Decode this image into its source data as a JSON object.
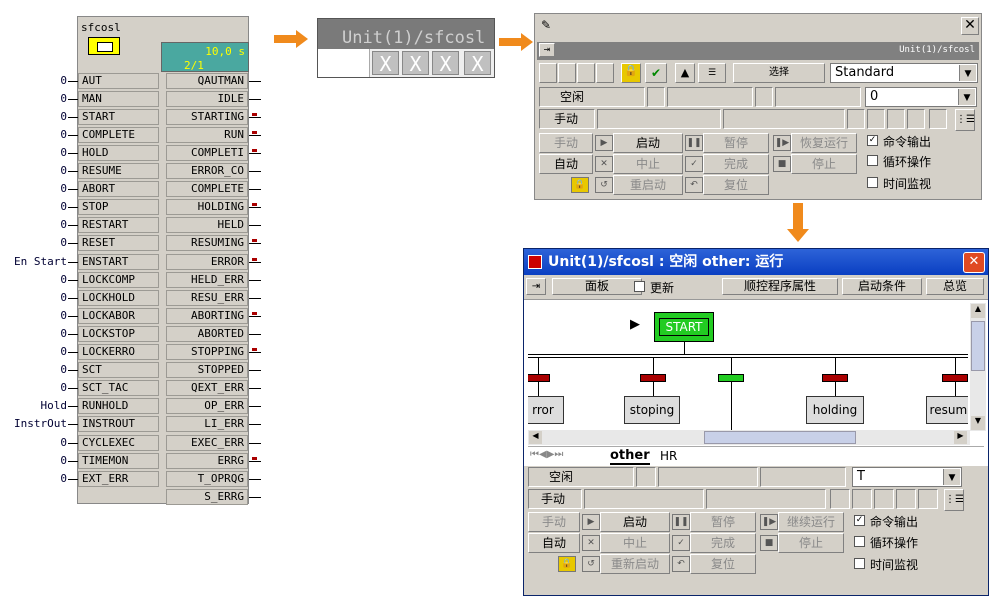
{
  "block": {
    "name": "sfcosl",
    "status_value": "10,0 s",
    "status_step": "2/1",
    "inputs": [
      {
        "name": "AUT",
        "value": "0"
      },
      {
        "name": "MAN",
        "value": "0"
      },
      {
        "name": "START",
        "value": "0"
      },
      {
        "name": "COMPLETE",
        "value": "0"
      },
      {
        "name": "HOLD",
        "value": "0"
      },
      {
        "name": "RESUME",
        "value": "0"
      },
      {
        "name": "ABORT",
        "value": "0"
      },
      {
        "name": "STOP",
        "value": "0"
      },
      {
        "name": "RESTART",
        "value": "0"
      },
      {
        "name": "RESET",
        "value": "0"
      },
      {
        "name": "ENSTART",
        "value": "En Start"
      },
      {
        "name": "LOCKCOMP",
        "value": "0"
      },
      {
        "name": "LOCKHOLD",
        "value": "0"
      },
      {
        "name": "LOCKABOR",
        "value": "0"
      },
      {
        "name": "LOCKSTOP",
        "value": "0"
      },
      {
        "name": "LOCKERRO",
        "value": "0"
      },
      {
        "name": "SCT",
        "value": "0"
      },
      {
        "name": "SCT_TAC",
        "value": "0"
      },
      {
        "name": "RUNHOLD",
        "value": "Hold"
      },
      {
        "name": "INSTROUT",
        "value": "InstrOut"
      },
      {
        "name": "CYCLEXEC",
        "value": "0"
      },
      {
        "name": "TIMEMON",
        "value": "0"
      },
      {
        "name": "EXT_ERR",
        "value": "0"
      }
    ],
    "outputs": [
      {
        "name": "QAUTMAN",
        "mark": false
      },
      {
        "name": "IDLE",
        "mark": false
      },
      {
        "name": "STARTING",
        "mark": true
      },
      {
        "name": "RUN",
        "mark": true
      },
      {
        "name": "COMPLETI",
        "mark": true
      },
      {
        "name": "ERROR_CO",
        "mark": false
      },
      {
        "name": "COMPLETE",
        "mark": false
      },
      {
        "name": "HOLDING",
        "mark": true
      },
      {
        "name": "HELD",
        "mark": false
      },
      {
        "name": "RESUMING",
        "mark": true
      },
      {
        "name": "ERROR",
        "mark": true
      },
      {
        "name": "HELD_ERR",
        "mark": false
      },
      {
        "name": "RESU_ERR",
        "mark": false
      },
      {
        "name": "ABORTING",
        "mark": true
      },
      {
        "name": "ABORTED",
        "mark": false
      },
      {
        "name": "STOPPING",
        "mark": true
      },
      {
        "name": "STOPPED",
        "mark": false
      },
      {
        "name": "QEXT_ERR",
        "mark": false
      },
      {
        "name": "OP_ERR",
        "mark": false
      },
      {
        "name": "LI_ERR",
        "mark": false
      },
      {
        "name": "EXEC_ERR",
        "mark": false
      },
      {
        "name": "ERRG",
        "mark": true
      },
      {
        "name": "T_OPRQG",
        "mark": false
      },
      {
        "name": "S_ERRG",
        "mark": false
      }
    ]
  },
  "mini": {
    "title": "Unit(1)/sfcosl",
    "buttons": [
      "X",
      "X",
      "X",
      "X"
    ]
  },
  "win1": {
    "path": "Unit(1)/sfcosl",
    "select_label": "选择",
    "view_select": "Standard",
    "state": "空闲",
    "step_select": "0",
    "mode": "手动",
    "buttons": {
      "manual": "手动",
      "start": "启动",
      "pause": "暂停",
      "resume": "恢复运行",
      "auto": "自动",
      "abort": "中止",
      "complete": "完成",
      "stop": "停止",
      "restart": "重启动",
      "reset": "复位"
    },
    "checks": [
      {
        "label": "命令输出",
        "checked": true
      },
      {
        "label": "循环操作",
        "checked": false
      },
      {
        "label": "时间监视",
        "checked": false
      }
    ]
  },
  "win2": {
    "title": "Unit(1)/sfcosl : 空闲 other: 运行",
    "toolbar": {
      "panel": "面板",
      "update": "更新",
      "seq_props": "顺控程序属性",
      "start_cond": "启动条件",
      "overview": "总览"
    },
    "start_step": "START",
    "steps": [
      "rror",
      "stoping",
      "holding",
      "resumi"
    ],
    "tabs": [
      "other",
      "HR"
    ],
    "state": "空闲",
    "step_select": "T",
    "mode": "手动",
    "buttons": {
      "manual": "手动",
      "start": "启动",
      "pause": "暂停",
      "resume": "继续运行",
      "auto": "自动",
      "abort": "中止",
      "complete": "完成",
      "stop": "停止",
      "restart": "重新启动",
      "reset": "复位"
    },
    "checks": [
      {
        "label": "命令输出",
        "checked": true
      },
      {
        "label": "循环操作",
        "checked": false
      },
      {
        "label": "时间监视",
        "checked": false
      }
    ]
  },
  "colors": {
    "arrow": "#f08a1c",
    "active_step": "#22cc22",
    "title_blue": "#0a3fc2"
  }
}
